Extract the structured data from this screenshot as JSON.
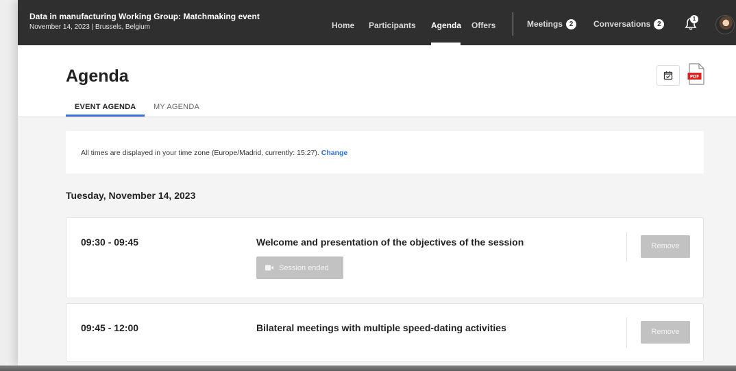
{
  "topbar": {
    "event_title": "Data in manufacturing Working Group: Matchmaking event",
    "event_subtitle": "November 14, 2023 | Brussels, Belgium",
    "nav": {
      "home": "Home",
      "participants": "Participants",
      "agenda": "Agenda",
      "offers": "Offers",
      "meetings": "Meetings",
      "meetings_count": "2",
      "conversations": "Conversations",
      "conversations_count": "2",
      "notifications_count": "1"
    },
    "active_tab": "Agenda"
  },
  "page": {
    "title": "Agenda",
    "tabs": [
      {
        "label": "EVENT AGENDA",
        "active": true
      },
      {
        "label": "MY AGENDA",
        "active": false
      }
    ],
    "icons": {
      "calendar": "calendar-check-icon",
      "pdf": "pdf-file-icon"
    }
  },
  "timezone": {
    "text": "All times are displayed in your time zone (Europe/Madrid, currently: 15:27).",
    "change_label": "Change"
  },
  "agenda": {
    "day": "Tuesday, November 14, 2023",
    "sessions": [
      {
        "time": "09:30 - 09:45",
        "title": "Welcome and presentation of the objectives of the session",
        "status_label": "Session ended",
        "remove_label": "Remove"
      },
      {
        "time": "09:45 - 12:00",
        "title": "Bilateral meetings with multiple speed-dating activities",
        "remove_label": "Remove"
      }
    ]
  },
  "colors": {
    "topbar_bg": "#2f2f2f",
    "accent_blue": "#3b6fd8",
    "link_blue": "#2c6dd5",
    "disabled_button": "#c2c2c2",
    "page_bg": "#f4f4f5"
  }
}
